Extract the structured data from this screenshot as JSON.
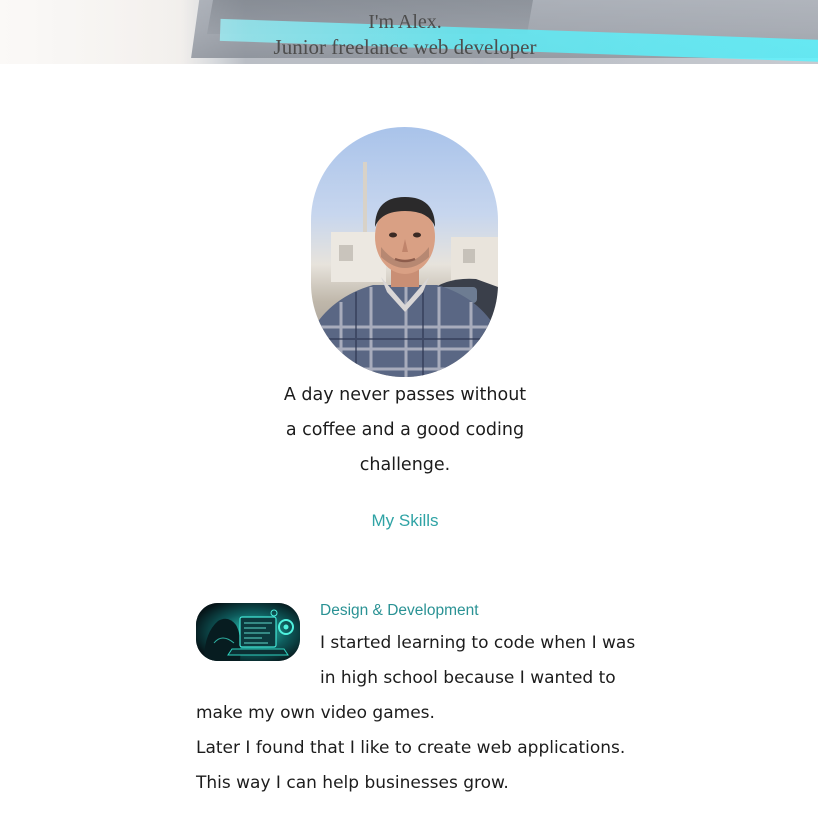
{
  "hero": {
    "greeting": "I'm Alex.",
    "role": "Junior freelance web developer"
  },
  "profile": {
    "avatar_icon": "profile-photo",
    "tagline": "A day never passes without a coffee and a good coding challenge."
  },
  "nav": {
    "skills_link": "My Skills"
  },
  "skills": [
    {
      "icon": "hacker-laptop-thumbnail",
      "title": "Design & Development",
      "paragraph_1": "I started learning to code when I was in high school because I wanted to make my own video games.",
      "paragraph_2": "Later I found that I like to create web applications. This way I can help businesses grow."
    }
  ],
  "colors": {
    "accent": "#2fa3a5",
    "hero_text": "#4d4d4d",
    "body_text": "#1c1c1c"
  }
}
